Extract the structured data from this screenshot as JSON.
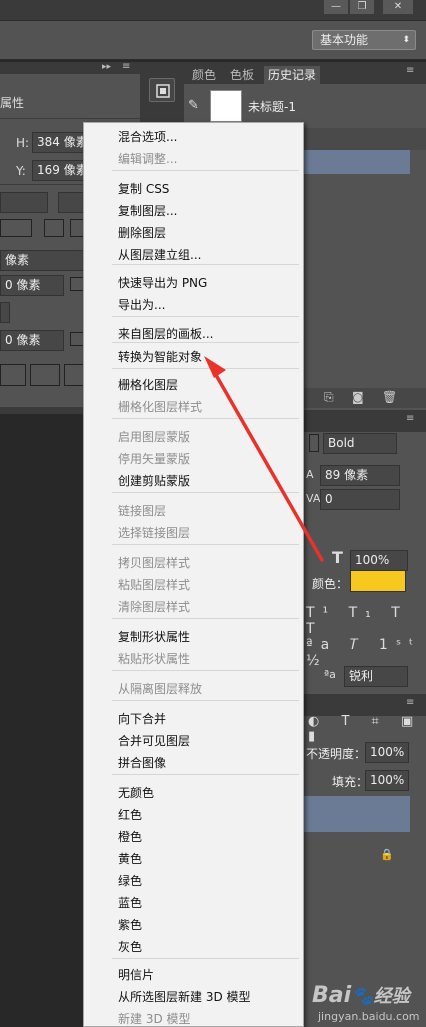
{
  "window": {
    "minimize": "—",
    "restore": "❐",
    "close": "✕"
  },
  "optionsbar": {
    "workspace": "基本功能",
    "workspace_arrow": "⬍"
  },
  "properties": {
    "title": "属性",
    "h_label": "H:",
    "h_value": "384 像素",
    "y_label": "Y:",
    "y_value": "169 像素",
    "row_a": "像素",
    "row_b": "0 像素",
    "row_c": "0 像素"
  },
  "history": {
    "tabs": [
      "颜色",
      "色板",
      "历史记录"
    ],
    "active_tab": "历史记录",
    "item": "未标题-1"
  },
  "character": {
    "font_style": "Bold",
    "size": "89 像素",
    "tracking": "0",
    "scale": "100%",
    "color_label": "颜色：",
    "color_value": "#f7c91e",
    "aa": "锐利",
    "aa_prefix": "ªa"
  },
  "layers": {
    "opacity_label": "不透明度：",
    "opacity": "100%",
    "fill_label": "填充：",
    "fill": "100%"
  },
  "menu": {
    "items": [
      {
        "label": "混合选项...",
        "disabled": false
      },
      {
        "label": "编辑调整...",
        "disabled": true
      },
      {
        "label": "复制 CSS",
        "disabled": false
      },
      {
        "label": "复制图层...",
        "disabled": false
      },
      {
        "label": "删除图层",
        "disabled": false
      },
      {
        "label": "从图层建立组...",
        "disabled": false
      },
      {
        "label": "快速导出为 PNG",
        "disabled": false
      },
      {
        "label": "导出为...",
        "disabled": false
      },
      {
        "label": "来自图层的画板...",
        "disabled": false
      },
      {
        "label": "转换为智能对象",
        "disabled": false
      },
      {
        "label": "栅格化图层",
        "disabled": false
      },
      {
        "label": "栅格化图层样式",
        "disabled": true
      },
      {
        "label": "启用图层蒙版",
        "disabled": true
      },
      {
        "label": "停用矢量蒙版",
        "disabled": true
      },
      {
        "label": "创建剪贴蒙版",
        "disabled": false
      },
      {
        "label": "链接图层",
        "disabled": true
      },
      {
        "label": "选择链接图层",
        "disabled": true
      },
      {
        "label": "拷贝图层样式",
        "disabled": true
      },
      {
        "label": "粘贴图层样式",
        "disabled": true
      },
      {
        "label": "清除图层样式",
        "disabled": true
      },
      {
        "label": "复制形状属性",
        "disabled": false
      },
      {
        "label": "粘贴形状属性",
        "disabled": true
      },
      {
        "label": "从隔离图层释放",
        "disabled": true
      },
      {
        "label": "向下合并",
        "disabled": false
      },
      {
        "label": "合并可见图层",
        "disabled": false
      },
      {
        "label": "拼合图像",
        "disabled": false
      },
      {
        "label": "无颜色",
        "disabled": false
      },
      {
        "label": "红色",
        "disabled": false
      },
      {
        "label": "橙色",
        "disabled": false
      },
      {
        "label": "黄色",
        "disabled": false
      },
      {
        "label": "绿色",
        "disabled": false
      },
      {
        "label": "蓝色",
        "disabled": false
      },
      {
        "label": "紫色",
        "disabled": false
      },
      {
        "label": "灰色",
        "disabled": false
      },
      {
        "label": "明信片",
        "disabled": false
      },
      {
        "label": "从所选图层新建 3D 模型",
        "disabled": false
      },
      {
        "label": "新建 3D 模型",
        "disabled": true
      }
    ]
  },
  "annotation": {
    "arrow_color": "#e8322a"
  },
  "watermark": {
    "brand": "Bai",
    "brand2": "经验",
    "domain": "jingyan.baidu.com"
  }
}
